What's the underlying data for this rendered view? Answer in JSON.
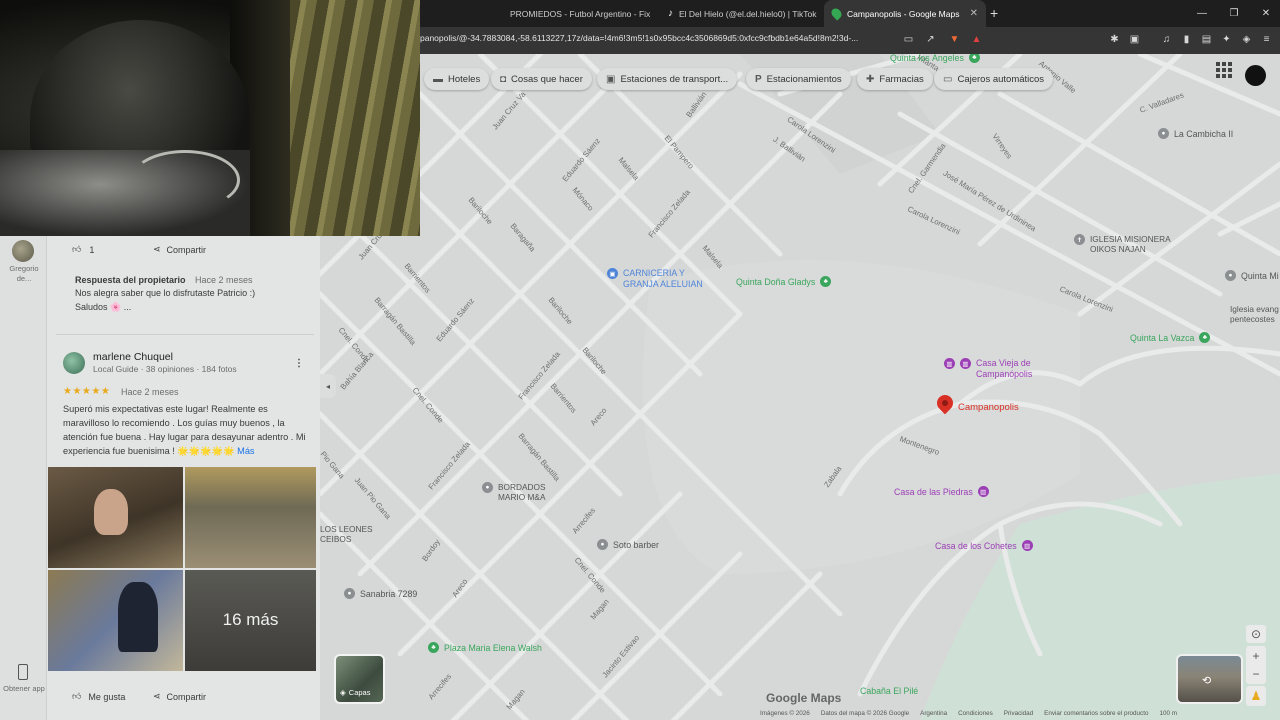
{
  "browser": {
    "tabs": [
      {
        "title": "PROMIEDOS - Futbol Argentino - Fix",
        "icon": "promiedos-icon",
        "active": false
      },
      {
        "title": "El Del Hielo (@el.del.hielo0) | TikTok",
        "icon": "tiktok-icon",
        "active": false
      },
      {
        "title": "Campanopolis - Google Maps",
        "icon": "google-maps-icon",
        "active": true
      }
    ],
    "new_tab": "+",
    "url": "panopolis/@-34.7883084,-58.6113227,17z/data=!4m6!3m5!1s0x95bcc4c3506869d5:0xfcc9cfbdb1e64a5d!8m2!3d-..."
  },
  "map": {
    "chips": [
      {
        "label": "Hoteles",
        "icon": "bed-icon"
      },
      {
        "label": "Cosas que hacer",
        "icon": "camera-icon"
      },
      {
        "label": "Estaciones de transport...",
        "icon": "train-icon"
      },
      {
        "label": "Estacionamientos",
        "icon": "parking-icon"
      },
      {
        "label": "Farmacias",
        "icon": "pharmacy-icon"
      },
      {
        "label": "Cajeros automáticos",
        "icon": "atm-icon"
      }
    ],
    "streets": [
      "Juan Cruz Va",
      "Juan Cruz Varela",
      "Bal",
      "Ballivián",
      "El Pampero",
      "Malsela",
      "Eduardo Sáenz",
      "Mónaco",
      "Francisco Zelada",
      "Carola Lorenzini",
      "J. Ballivián",
      "Infanta Isabel",
      "Antonio Valle",
      "C. Valladares",
      "Virreyes",
      "Cnel. Garmendia",
      "José María Pérez de Urdininea",
      "Barrientos",
      "Bariloche",
      "Baragaña",
      "Malsela",
      "Carola Lorenzini",
      "Carola Lorenzini",
      "Juan Cruz Va",
      "Barragán Bastilla",
      "Cnel. Conde",
      "Eduardo Sáenz",
      "Bariloche",
      "Bahía Blanca",
      "Francisco Zelada",
      "Barrientos",
      "Bariloche",
      "Cnel. Conde",
      "Francisco Zelada",
      "Barragán Bastilla",
      "Areco",
      "Montenegro",
      "Zabala",
      "Juan Pio Gana",
      "Pio Gana",
      "Bordoy",
      "Arrecifes",
      "Cnel. Conde",
      "Areco",
      "Magan",
      "Jacinto Estivao",
      "Arrecifes",
      "Magan"
    ],
    "pois": [
      {
        "label": "Quinta los Ángeles",
        "kind": "green"
      },
      {
        "label": "La Cambicha II",
        "kind": "gray"
      },
      {
        "label": "IGLESIA MISIONERA\nOIKOS NAJAN",
        "kind": "gray"
      },
      {
        "label": "Quinta Mi",
        "kind": "gray"
      },
      {
        "label": "Iglesia evang\npentecostes",
        "kind": "gray"
      },
      {
        "label": "Quinta La Vazca",
        "kind": "green"
      },
      {
        "label": "CARNICERIA Y\nGRANJA ALELUIAN",
        "kind": "blue"
      },
      {
        "label": "Quinta Doña Gladys",
        "kind": "green"
      },
      {
        "label": "Casa Vieja de\nCampanópolis",
        "kind": "purple"
      },
      {
        "label": "Casa de las Piedras",
        "kind": "purple"
      },
      {
        "label": "Casa de los Cohetes",
        "kind": "purple"
      },
      {
        "label": "BORDADOS\nMARIO M&A",
        "kind": "gray"
      },
      {
        "label": "LOS LEONES\nCEIBOS",
        "kind": "gray"
      },
      {
        "label": "Soto barber",
        "kind": "gray"
      },
      {
        "label": "Sanabria 7289",
        "kind": "gray"
      },
      {
        "label": "Plaza Maria Elena Walsh",
        "kind": "green"
      },
      {
        "label": "Cabaña El Pilé",
        "kind": "green"
      }
    ],
    "selected_place": "Campanopolis",
    "layers_label": "Capas",
    "logo": "Google Maps",
    "footer": [
      "Imágenes © 2026",
      "Datos del mapa © 2026 Google",
      "Argentina",
      "Condiciones",
      "Privacidad",
      "Enviar comentarios sobre el producto",
      "100 m"
    ]
  },
  "sidebar": {
    "reviewer_top": "Gregorio de...",
    "get_app": "Obtener app"
  },
  "review_prev": {
    "likes": "1",
    "share": "Compartir",
    "owner_reply_title": "Respuesta del propietario",
    "owner_reply_time": "Hace 2 meses",
    "owner_reply_text": "Nos alegra saber que lo disfrutaste Patricio :)",
    "owner_reply_text2": "Saludos 🌸 ..."
  },
  "review": {
    "author": "marlene Chuquel",
    "meta": "Local Guide · 38 opiniones · 184 fotos",
    "rating": 5,
    "stars": "★★★★★",
    "time": "Hace 2 meses",
    "text": "Superó mis expectativas este lugar! Realmente es maravilloso lo recomiendo . Los guías muy buenos , la atención fue buena . Hay lugar para desayunar adentro . Mi experiencia fue buenisima ! 🌟🌟🌟🌟🌟",
    "more": "Más",
    "more_photos": "16 más",
    "like": "Me gusta",
    "share": "Compartir"
  },
  "colors": {
    "map_bg": "#d6d8d8",
    "road": "#e8e9e9",
    "park": "#cfe0d6",
    "pin": "#d93025",
    "purple": "#9b3fb5",
    "blue": "#4e84d8",
    "green": "#3aa55c"
  }
}
